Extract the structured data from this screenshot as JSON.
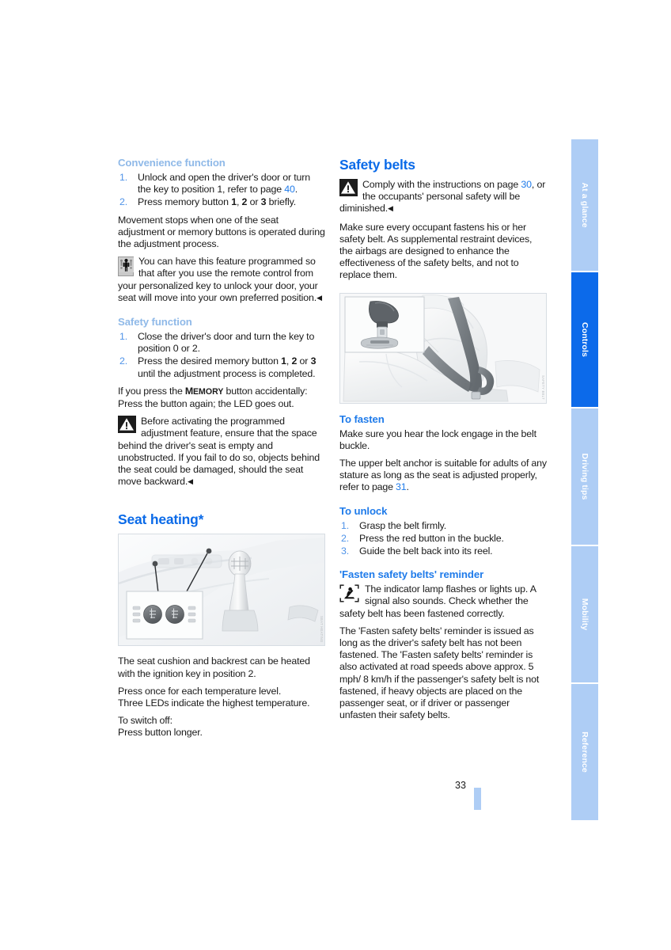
{
  "document": {
    "page_number": "33"
  },
  "sidebar": {
    "tabs": [
      {
        "label": "At a glance",
        "active": false
      },
      {
        "label": "Controls",
        "active": true
      },
      {
        "label": "Driving tips",
        "active": false
      },
      {
        "label": "Mobility",
        "active": false
      },
      {
        "label": "Reference",
        "active": false
      }
    ]
  },
  "left_column": {
    "convenience": {
      "heading": "Convenience function",
      "steps": [
        {
          "num": "1.",
          "text_before": "Unlock and open the driver's door or turn the key to position 1, refer to page ",
          "page_ref": "40",
          "text_after": "."
        },
        {
          "num": "2.",
          "text": "Press memory button 1, 2 or 3 briefly."
        }
      ],
      "paragraph": "Movement stops when one of the seat adjustment or memory buttons is operated during the adjustment process.",
      "note": {
        "icon": "personalization-icon",
        "text": "You can have this feature programmed so that after you use the remote control from your personalized key to unlock your door, your seat will move into your own preferred position."
      }
    },
    "safety_function": {
      "heading": "Safety function",
      "steps": [
        {
          "num": "1.",
          "text": "Close the driver's door and turn the key to position 0 or 2."
        },
        {
          "num": "2.",
          "text": "Press the desired memory button 1, 2 or 3 until the adjustment process is completed."
        }
      ],
      "memory_note_line1_pre": "If you press the ",
      "memory_note_m": "M",
      "memory_note_emory": "EMORY",
      "memory_note_line1_post": " button accidentally:",
      "memory_note_line2": "Press the button again; the LED goes out.",
      "warning": {
        "icon": "warning-triangle-icon",
        "text": "Before activating the programmed adjustment feature, ensure that the space behind the driver's seat is empty and unobstructed. If you fail to do so, objects behind the seat could be damaged, should the seat move backward."
      }
    },
    "seat_heating": {
      "heading": "Seat heating*",
      "figure": {
        "name": "seat-heating-controls-photo",
        "credit": "SEAT HEATING"
      },
      "paragraphs": [
        "The seat cushion and backrest can be heated with the ignition key in position 2.",
        "Press once for each temperature level.\nThree LEDs indicate the highest temperature.",
        "To switch off:\nPress button longer."
      ]
    }
  },
  "right_column": {
    "safety_belts": {
      "heading": "Safety belts",
      "warning": {
        "icon": "warning-triangle-icon",
        "text_before": "Comply with the instructions on page ",
        "page_ref": "30",
        "text_after": ", or the occupants' personal safety will be diminished."
      },
      "paragraph": "Make sure every occupant fastens his or her safety belt. As supplemental restraint devices, the airbags are designed to enhance the effectiveness of the safety belts, and not to replace them.",
      "figure": {
        "name": "safety-belt-buckle-photo",
        "credit": "SAFETY BELT"
      }
    },
    "to_fasten": {
      "heading": "To fasten",
      "paragraph1": "Make sure you hear the lock engage in the belt buckle.",
      "paragraph2_before": "The upper belt anchor is suitable for adults of any stature as long as the seat is adjusted properly, refer to page ",
      "paragraph2_ref": "31",
      "paragraph2_after": "."
    },
    "to_unlock": {
      "heading": "To unlock",
      "steps": [
        {
          "num": "1.",
          "text": "Grasp the belt firmly."
        },
        {
          "num": "2.",
          "text": "Press the red button in the buckle."
        },
        {
          "num": "3.",
          "text": "Guide the belt back into its reel."
        }
      ]
    },
    "reminder": {
      "heading": "'Fasten safety belts' reminder",
      "note": {
        "icon": "seatbelt-reminder-icon",
        "text": "The indicator lamp flashes or lights up. A signal also sounds. Check whether the safety belt has been fastened correctly."
      },
      "paragraph": "The 'Fasten safety belts' reminder is issued as long as the driver's safety belt has not been fastened. The 'Fasten safety belts' reminder is also activated at road speeds above approx. 5 mph/ 8 km/h if the passenger's safety belt is not fastened, if heavy objects are placed on the passenger seat, or if driver or passenger unfasten their safety belts."
    }
  },
  "colors": {
    "accent_blue": "#0a6ae8",
    "light_blue": "#8fb9e8",
    "tab_blue": "#aecdf5",
    "tab_active": "#0c6aea"
  }
}
